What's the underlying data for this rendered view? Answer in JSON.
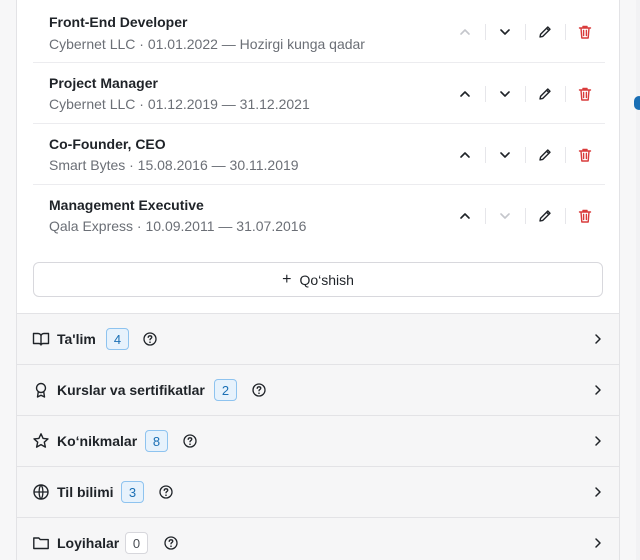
{
  "experience": [
    {
      "title": "Front-End Developer",
      "subtitle": "Cybernet LLC · 01.01.2022 — Hozirgi kunga qadar",
      "up_enabled": false,
      "down_enabled": true
    },
    {
      "title": "Project Manager",
      "subtitle": "Cybernet LLC · 01.12.2019 — 31.12.2021",
      "up_enabled": true,
      "down_enabled": true
    },
    {
      "title": "Co-Founder, CEO",
      "subtitle": "Smart Bytes · 15.08.2016 — 30.11.2019",
      "up_enabled": true,
      "down_enabled": true
    },
    {
      "title": "Management Executive",
      "subtitle": "Qala Express · 10.09.2011 — 31.07.2016",
      "up_enabled": true,
      "down_enabled": false
    }
  ],
  "add_button": {
    "label": "Qo‘shish"
  },
  "sections": [
    {
      "title": "Ta'lim",
      "count": "4",
      "icon": "book-icon"
    },
    {
      "title": "Kurslar va sertifikatlar",
      "count": "2",
      "icon": "award-icon"
    },
    {
      "title": "Ko‘nikmalar",
      "count": "8",
      "icon": "star-icon"
    },
    {
      "title": "Til bilimi",
      "count": "3",
      "icon": "globe-icon"
    },
    {
      "title": "Loyihalar",
      "count": "0",
      "icon": "folder-icon"
    }
  ],
  "colors": {
    "accent": "#1a6fb5",
    "delete": "#d93b3b",
    "disabled": "#c4c6cb"
  }
}
